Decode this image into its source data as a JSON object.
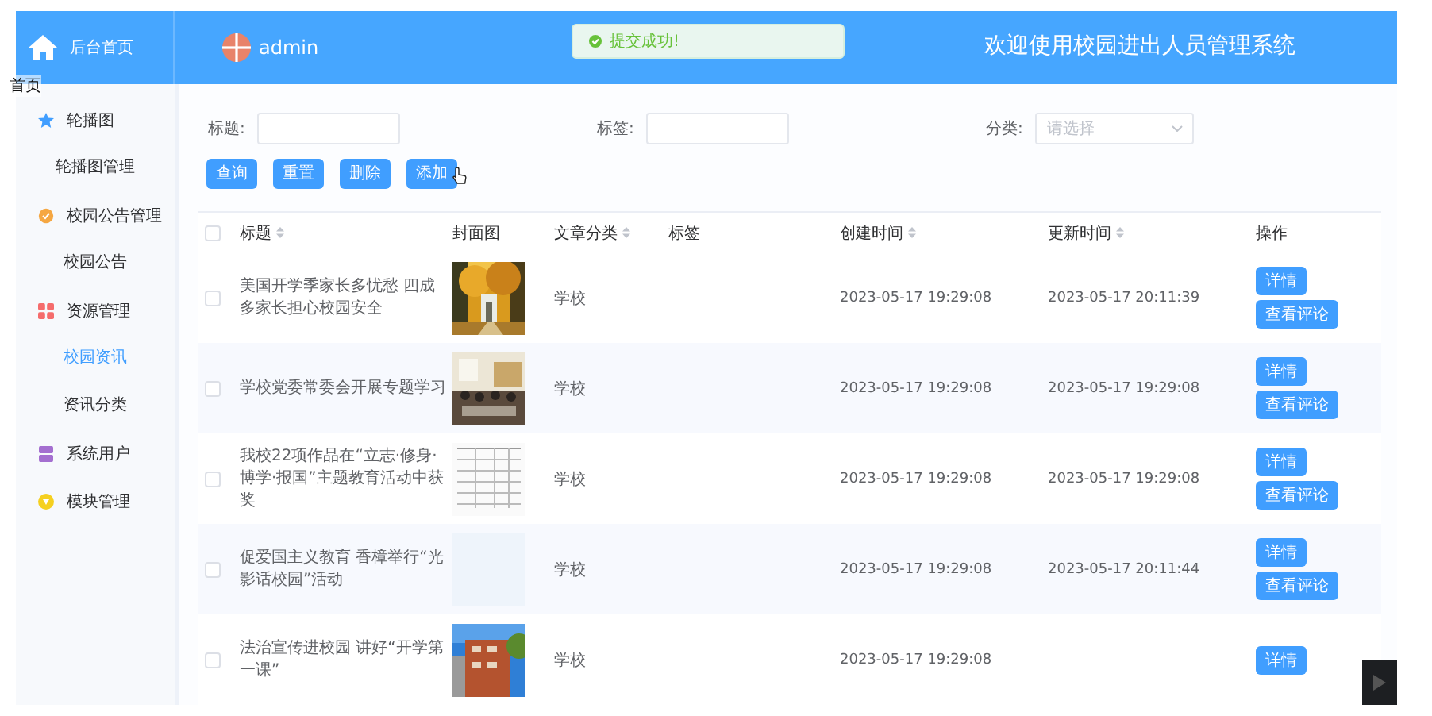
{
  "header": {
    "home_label": "后台首页",
    "user": "admin",
    "toast": {
      "kind": "success",
      "message": "提交成功!"
    },
    "title": "欢迎使用校园进出人员管理系统"
  },
  "overlay_label": "首页",
  "sidebar": {
    "groups": [
      {
        "label": "轮播图",
        "children": [
          {
            "label": "轮播图管理",
            "selected": false
          }
        ]
      },
      {
        "label": "校园公告管理",
        "children": [
          {
            "label": "校园公告",
            "selected": false
          }
        ]
      },
      {
        "label": "资源管理",
        "children": [
          {
            "label": "校园资讯",
            "selected": true
          },
          {
            "label": "资讯分类",
            "selected": false
          }
        ]
      },
      {
        "label": "系统用户"
      },
      {
        "label": "模块管理"
      }
    ]
  },
  "filters": [
    {
      "kind": "text",
      "label": "标题:"
    },
    {
      "kind": "text",
      "label": "标签:"
    },
    {
      "kind": "select",
      "label": "分类:",
      "placeholder": "请选择"
    }
  ],
  "actions": [
    "查询",
    "重置",
    "删除",
    "添加"
  ],
  "table": {
    "header_checkbox": {
      "checked": false
    },
    "columns": [
      {
        "label": "标题",
        "sortable": true
      },
      {
        "label": "封面图",
        "sortable": false
      },
      {
        "label": "文章分类",
        "sortable": true
      },
      {
        "label": "标签",
        "sortable": false
      },
      {
        "label": "创建时间",
        "sortable": true
      },
      {
        "label": "更新时间",
        "sortable": true
      },
      {
        "label": "操作",
        "sortable": false
      }
    ],
    "rows": [
      {
        "checked": false,
        "title": "美国开学季家长多忧愁 四成多家长担心校园安全",
        "cover": {
          "kind": "picture"
        },
        "category": "学校",
        "created": "2023-05-17 19:29:08",
        "updated": "2023-05-17 20:11:39",
        "buttons": [
          "详情",
          "查看评论"
        ]
      },
      {
        "checked": false,
        "title": "学校党委常委会开展专题学习",
        "cover": {
          "kind": "picture"
        },
        "category": "学校",
        "created": "2023-05-17 19:29:08",
        "updated": "2023-05-17 19:29:08",
        "buttons": [
          "详情",
          "查看评论"
        ]
      },
      {
        "checked": false,
        "title": "我校22项作品在“立志·修身·博学·报国”主题教育活动中获奖",
        "cover": {
          "kind": "picture"
        },
        "category": "学校",
        "created": "2023-05-17 19:29:08",
        "updated": "2023-05-17 19:29:08",
        "buttons": [
          "详情",
          "查看评论"
        ]
      },
      {
        "checked": false,
        "title": "促爱国主义教育 香樟举行“光影话校园”活动",
        "cover": {
          "kind": "empty"
        },
        "category": "学校",
        "created": "2023-05-17 19:29:08",
        "updated": "2023-05-17 20:11:44",
        "buttons": [
          "详情",
          "查看评论"
        ]
      },
      {
        "checked": false,
        "title": "法治宣传进校园 讲好“开学第一课”",
        "cover": {
          "kind": "picture"
        },
        "category": "学校",
        "created": "2023-05-17 19:29:08",
        "buttons": [
          "详情"
        ]
      }
    ]
  }
}
